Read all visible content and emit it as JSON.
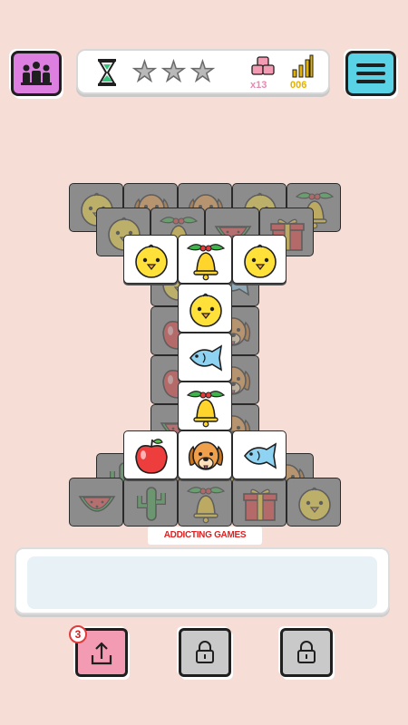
{
  "header": {
    "stars_earned": 0,
    "stars_total": 3,
    "hint_count": "x13",
    "level_count": "006"
  },
  "branding": {
    "label": "ADDICTING GAMES"
  },
  "powerups": {
    "undo_count": "3"
  },
  "icons": {
    "left_button": "family-icon",
    "menu_button": "hamburger-icon",
    "timer": "hourglass-icon",
    "hint": "stacked-tiles-icon",
    "level": "signal-bars-icon",
    "undo": "undo-arrow-icon",
    "locked": "lock-icon"
  },
  "colors": {
    "background": "#f6ddd5",
    "left_button": "#dd7fe0",
    "menu_button": "#5ad2e6",
    "undo_button": "#f49bb4",
    "locked_button": "#c9c9c9",
    "hint_text": "#e789b4",
    "level_text": "#e3b100",
    "brand_text": "#e02020"
  },
  "board": {
    "tiles": [
      {
        "type": "chick",
        "state": "covered"
      },
      {
        "type": "dog",
        "state": "covered"
      },
      {
        "type": "dog",
        "state": "covered"
      },
      {
        "type": "chick",
        "state": "covered"
      },
      {
        "type": "bell",
        "state": "covered"
      },
      {
        "type": "chick",
        "state": "covered"
      },
      {
        "type": "bell",
        "state": "covered"
      },
      {
        "type": "watermelon",
        "state": "covered"
      },
      {
        "type": "gift",
        "state": "covered"
      },
      {
        "type": "fish",
        "state": "covered"
      },
      {
        "type": "chick",
        "state": "covered"
      },
      {
        "type": "apple",
        "state": "covered"
      },
      {
        "type": "dog",
        "state": "covered"
      },
      {
        "type": "apple",
        "state": "covered"
      },
      {
        "type": "dog",
        "state": "covered"
      },
      {
        "type": "watermelon",
        "state": "covered"
      },
      {
        "type": "dog",
        "state": "covered"
      },
      {
        "type": "cactus",
        "state": "covered"
      },
      {
        "type": "dog",
        "state": "covered"
      },
      {
        "type": "chick",
        "state": "covered"
      },
      {
        "type": "dog",
        "state": "covered"
      },
      {
        "type": "watermelon",
        "state": "covered"
      },
      {
        "type": "cactus",
        "state": "covered"
      },
      {
        "type": "bell",
        "state": "covered"
      },
      {
        "type": "gift",
        "state": "covered"
      },
      {
        "type": "chick",
        "state": "covered"
      },
      {
        "type": "chick",
        "state": "open"
      },
      {
        "type": "bell",
        "state": "open"
      },
      {
        "type": "chick",
        "state": "open"
      },
      {
        "type": "chick",
        "state": "open"
      },
      {
        "type": "fish",
        "state": "open"
      },
      {
        "type": "bell",
        "state": "open"
      },
      {
        "type": "apple",
        "state": "open"
      },
      {
        "type": "dog",
        "state": "open"
      },
      {
        "type": "fish",
        "state": "open"
      }
    ]
  }
}
